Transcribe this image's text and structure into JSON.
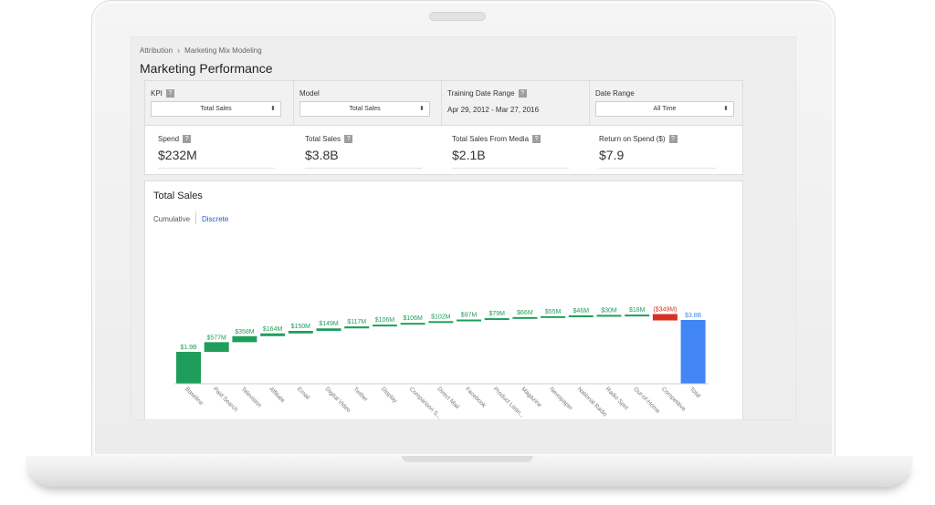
{
  "breadcrumb": {
    "root": "Attribution",
    "separator": "›",
    "current": "Marketing Mix Modeling"
  },
  "page_title": "Marketing Performance",
  "filters": {
    "kpi": {
      "label": "KPI",
      "help": "?",
      "value": "Total Sales",
      "arrows": "⬍"
    },
    "model": {
      "label": "Model",
      "value": "Total Sales",
      "arrows": "⬍"
    },
    "training": {
      "label": "Training Date Range",
      "help": "?",
      "value": "Apr 29, 2012 - Mar 27, 2016"
    },
    "date_range": {
      "label": "Date Range",
      "value": "All Time",
      "arrows": "⬍"
    }
  },
  "kpis": [
    {
      "label": "Spend",
      "help": "?",
      "value": "$232M"
    },
    {
      "label": "Total Sales",
      "help": "?",
      "value": "$3.8B"
    },
    {
      "label": "Total Sales From Media",
      "help": "?",
      "value": "$2.1B"
    },
    {
      "label": "Return on Spend ($)",
      "help": "?",
      "value": "$7.9"
    }
  ],
  "chart_card": {
    "title": "Total Sales",
    "tabs": {
      "cumulative": "Cumulative",
      "discrete": "Discrete",
      "active": "discrete"
    }
  },
  "colors": {
    "positive": "#1e9e5a",
    "negative": "#d93025",
    "total": "#4285f4",
    "label_positive": "#1e9e5a",
    "label_negative": "#d93025",
    "label_total": "#4285f4"
  },
  "chart_data": {
    "type": "bar",
    "subtype": "waterfall",
    "title": "Total Sales",
    "categories": [
      "Baseline",
      "Paid Search",
      "Television",
      "Affiliate",
      "Email",
      "Digital Video",
      "Twitter",
      "Display",
      "Comparison S...",
      "Direct Mail",
      "Facebook",
      "Product Listin...",
      "Magazine",
      "Newspaper",
      "National Radio",
      "Radio Spot",
      "Out-of-Home",
      "Competitive",
      "Total"
    ],
    "values": [
      1900,
      577,
      358,
      164,
      150,
      149,
      117,
      106,
      106,
      102,
      97,
      79,
      66,
      55,
      46,
      30,
      18,
      -349,
      3800
    ],
    "value_labels": [
      "$1.9B",
      "$577M",
      "$358M",
      "$164M",
      "$150M",
      "$149M",
      "$117M",
      "$106M",
      "$106M",
      "$102M",
      "$97M",
      "$79M",
      "$66M",
      "$55M",
      "$46M",
      "$30M",
      "$18M",
      "($349M)",
      "$3.8B"
    ],
    "unit": "$M",
    "xlabel": "",
    "ylabel": "",
    "grid": false,
    "legend": "none"
  }
}
